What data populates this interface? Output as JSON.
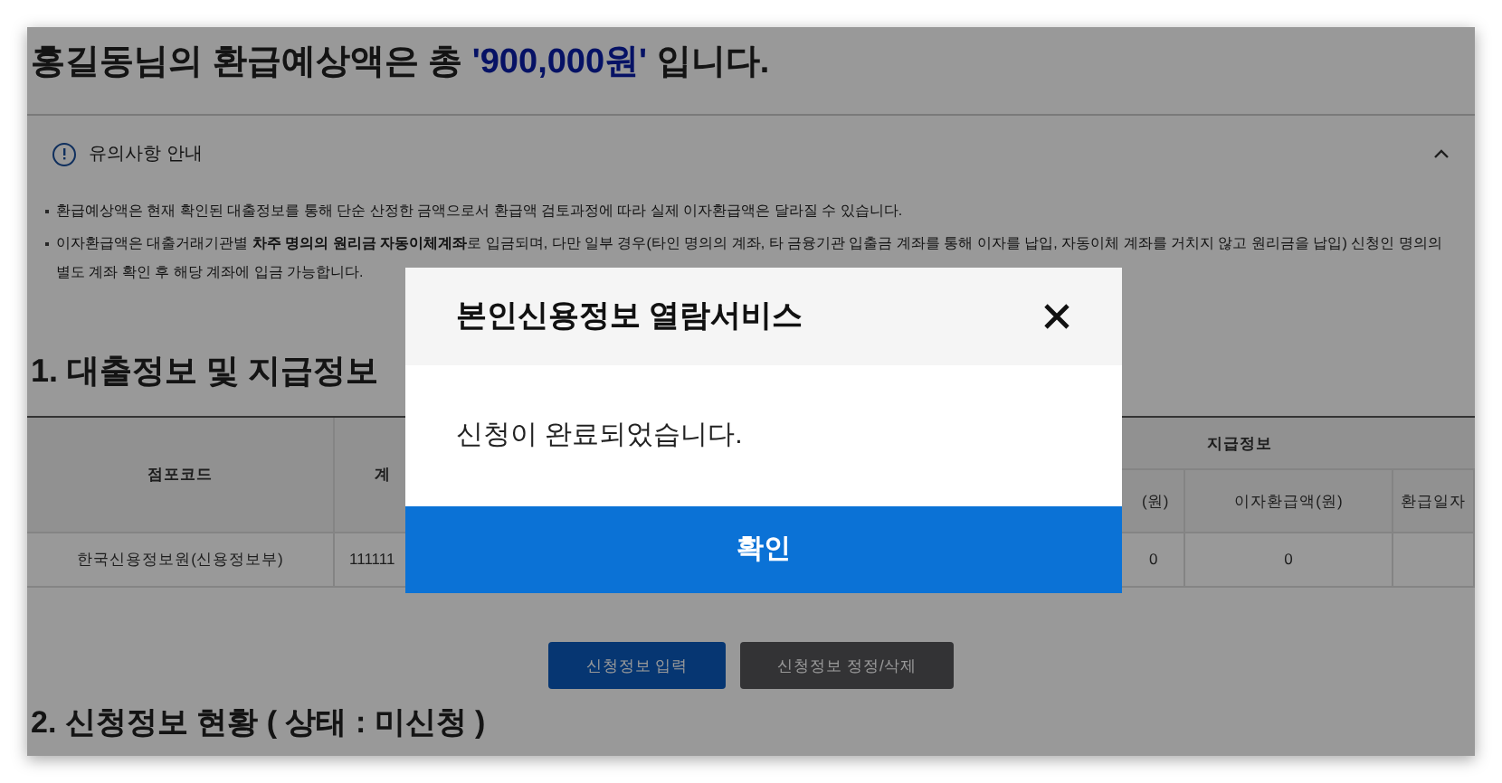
{
  "heading": {
    "prefix": "홍길동님의 환급예상액은 총 ",
    "amount": "'900,000원'",
    "suffix": " 입니다."
  },
  "notice": {
    "title": "유의사항 안내",
    "expanded": true,
    "items": [
      "환급예상액은 현재 확인된 대출정보를 통해 단순 산정한 금액으로서 환급액 검토과정에 따라 실제 이자환급액은 달라질 수 있습니다.",
      "이자환급액은 대출거래기관별 **차주 명의의 원리금 자동이체계좌**로 입금되며, 다만 일부 경우(타인 명의의 계좌, 타 금융기관 입출금 계좌를 통해 이자를 납입, 자동이체 계좌를 거치지 않고 원리금을 납입) 신청인 명의의 별도 계좌 확인 후 해당 계좌에 입금 가능합니다."
    ]
  },
  "section_title": "1. 대출정보 및 지급정보",
  "table": {
    "group_header": "지급정보",
    "columns": [
      {
        "label": "점포코드"
      },
      {
        "label": "계"
      },
      {
        "label": "(원)"
      },
      {
        "label": "이자환급액(원)"
      },
      {
        "label": "환급일자"
      }
    ],
    "rows": [
      {
        "cells": [
          "한국신용정보원(신용정보부)",
          "111111",
          "0",
          "0"
        ]
      }
    ]
  },
  "buttons": [
    {
      "label": "신청정보 입력",
      "kind": "primary"
    },
    {
      "label": "신청정보 정정/삭제",
      "kind": "secondary"
    }
  ],
  "next_section_title": "2. 신청정보 현황 ( 상태 : 미신청 )",
  "modal": {
    "title": "본인신용정보 열람서비스",
    "message": "신청이 완료되었습니다.",
    "confirm": "확인"
  }
}
